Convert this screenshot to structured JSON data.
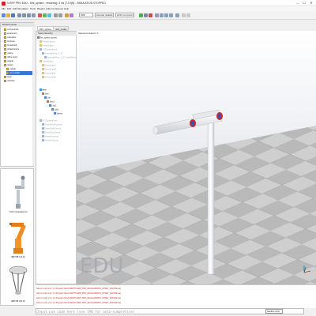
{
  "window": {
    "title": "V-REP PRO EDU - Dirk_sphere - rendering: 3 ms (7.5 fps) - SIMULATION STOPPED",
    "controls": [
      "—",
      "☐",
      "✕"
    ]
  },
  "menu": [
    "File",
    "Edit",
    "Add",
    "Simulation",
    "Tools",
    "Plugins",
    "Add-ons",
    "Scenes",
    "Help"
  ],
  "toolbar": {
    "engine": "ODE",
    "accuracy": "Accurate (default)",
    "timestep": "dt=50 ms (custom)"
  },
  "model_browser": {
    "title": "Model browser",
    "items": [
      {
        "label": "components"
      },
      {
        "label": "equipment"
      },
      {
        "label": "examples"
      },
      {
        "label": "furniture"
      },
      {
        "label": "household"
      },
      {
        "label": "infrastructure"
      },
      {
        "label": "nature"
      },
      {
        "label": "office items"
      },
      {
        "label": "people"
      },
      {
        "label": "robots"
      },
      {
        "label": "mobile"
      },
      {
        "label": "non-mobile"
      },
      {
        "label": "tools"
      },
      {
        "label": "vehicles"
      }
    ]
  },
  "robot_panel": {
    "items": [
      {
        "label": "7 DoF manipulator.ttm"
      },
      {
        "label": "ABB IRB 140.ttm"
      },
      {
        "label": "ABB IRB 360.ttm"
      }
    ]
  },
  "doc_tabs": [
    "Dirk_sphere",
    "new_model"
  ],
  "scene_hierarchy": {
    "title": "Scene hierarchy",
    "nodes": [
      {
        "label": "Dirk_sphere (scene)"
      },
      {
        "label": "DefaultCamera"
      },
      {
        "label": "DefaultLights"
      },
      {
        "label": "XYZCameraProxy"
      },
      {
        "label": "ResizableFloor_5_25"
      },
      {
        "label": "ResizableFloor_5_25_visibleElement"
      },
      {
        "label": "DefaultLights"
      },
      {
        "label": "DefaultLightA"
      },
      {
        "label": "DefaultLightB"
      },
      {
        "label": "DefaultLightC"
      },
      {
        "label": "DefaultLightD"
      },
      {
        "label": "Base"
      },
      {
        "label": "Joint"
      },
      {
        "label": "Link"
      },
      {
        "label": "Joint1"
      },
      {
        "label": "Link1"
      },
      {
        "label": "Link2"
      },
      {
        "label": "Sphere"
      },
      {
        "label": "XYZCameraProxy"
      },
      {
        "label": "DefaultFrontCamera"
      },
      {
        "label": "DefaultSideCamera"
      },
      {
        "label": "DefaultTopCamera"
      },
      {
        "label": "DefaultXCamera"
      },
      {
        "label": "DefaultYCamera"
      }
    ]
  },
  "viewport": {
    "label": "Selected objects: 0",
    "watermark": "EDU"
  },
  "console": {
    "lines": [
      "Add-on script error: [C:/Program Files/V-REP3/V-REP_PRO_EDU/lua/BWFW_INTSET_IGNORE.lua]",
      "Add-on script error: [C:/Program Files/V-REP3/V-REP_PRO_EDU/lua/BWFW_INTSET_IGNORE.lua]",
      "Add-on script error: [C:/Program Files/V-REP3/V-REP_PRO_EDU/lua/BWFW_INTSET_IGNORE.lua]",
      "Add-on script error: [C:/Program Files/V-REP3/V-REP_PRO_EDU/lua/BWFW_INTSET_IGNORE.lua]"
    ],
    "input_placeholder": "Input Lua code here (use TAB for auto-completion)",
    "sandbox": "Sandbox script"
  }
}
